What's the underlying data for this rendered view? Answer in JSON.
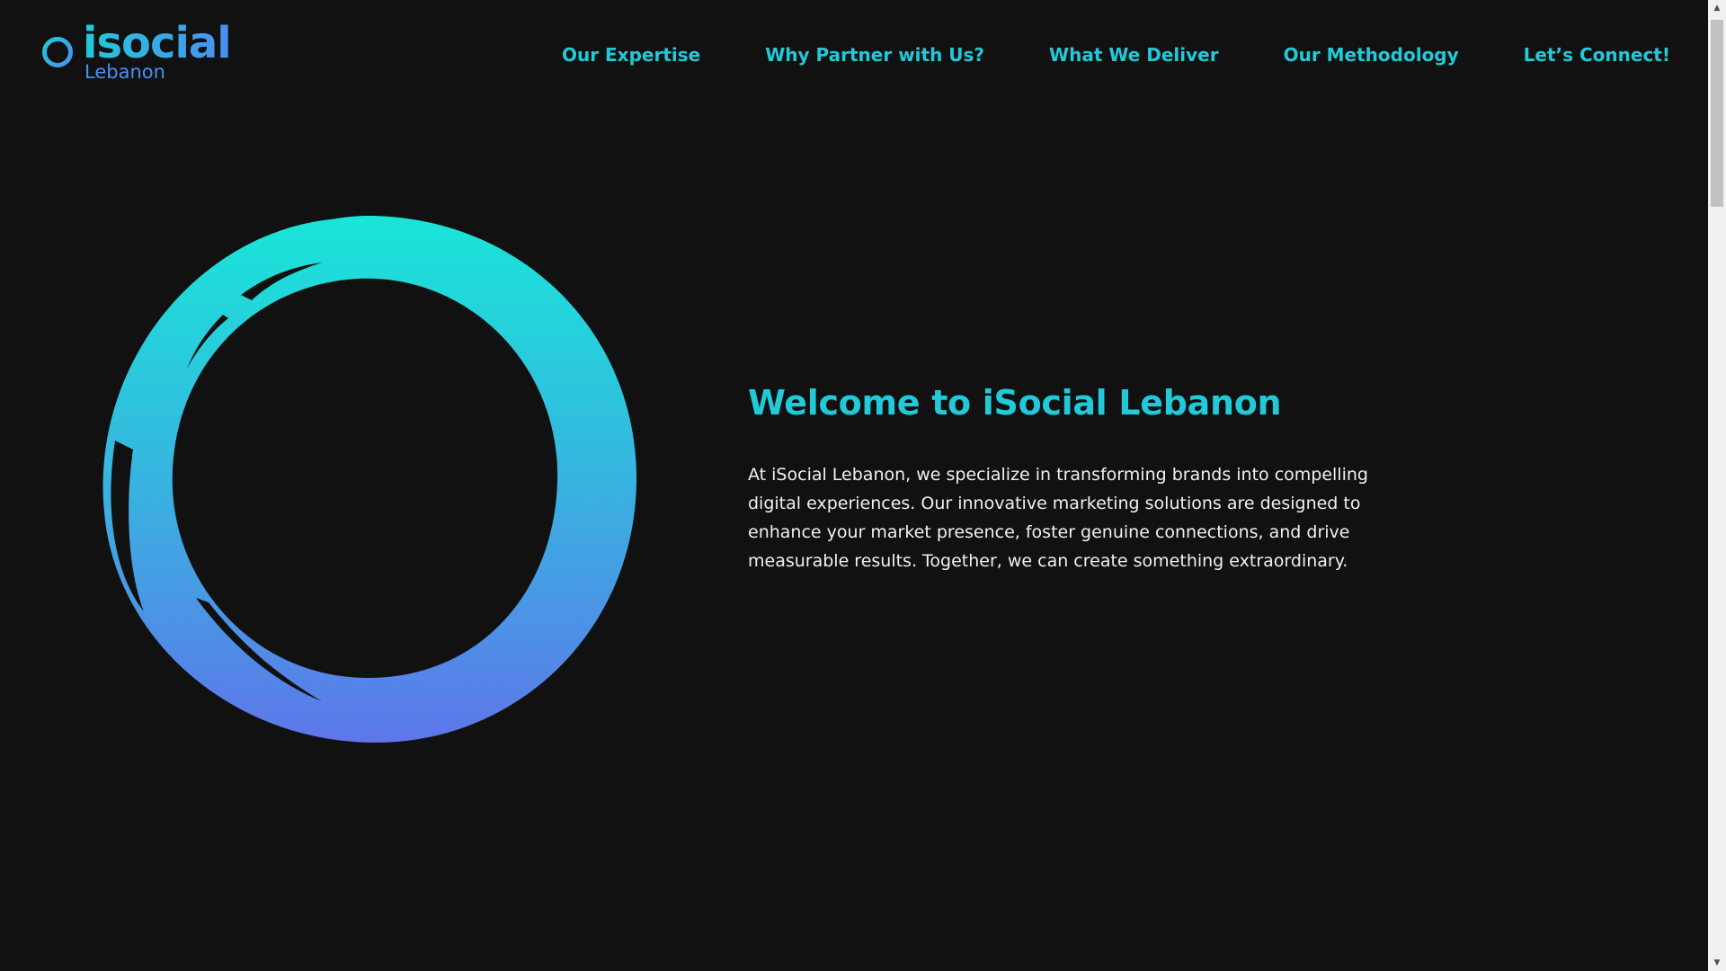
{
  "brand": {
    "logo_word": "isocial",
    "logo_sub": "Lebanon",
    "accent_cyan": "#22c9d8",
    "accent_blue": "#5b7cf0",
    "background": "#111111"
  },
  "nav": {
    "items": [
      {
        "label": "Our Expertise"
      },
      {
        "label": "Why Partner with Us?"
      },
      {
        "label": "What We Deliver"
      },
      {
        "label": "Our Methodology"
      },
      {
        "label": "Let’s Connect!"
      }
    ]
  },
  "hero": {
    "title": "Welcome to iSocial Lebanon",
    "body": "At iSocial Lebanon, we specialize in transforming brands into compelling digital experiences. Our innovative marketing solutions are designed to enhance your market presence, foster genuine connections, and drive measurable results. Together, we can create something extraordinary."
  },
  "icons": {
    "logo_ring": "ring-icon",
    "hero_ring": "brush-circle-graphic"
  }
}
